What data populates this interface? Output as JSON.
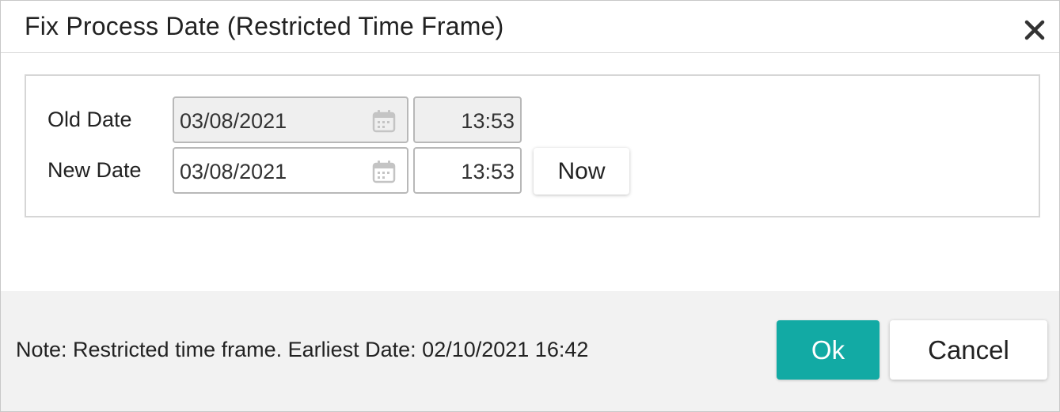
{
  "dialog": {
    "title": "Fix Process Date (Restricted Time Frame)",
    "close_icon": "close-icon"
  },
  "old_date": {
    "label": "Old Date",
    "date": "03/08/2021",
    "time": "13:53",
    "disabled": true,
    "calendar_icon": "calendar-icon"
  },
  "new_date": {
    "label": "New Date",
    "date": "03/08/2021",
    "time": "13:53",
    "calendar_icon": "calendar-icon",
    "now_label": "Now"
  },
  "footer": {
    "note": "Note: Restricted time frame. Earliest Date: 02/10/2021 16:42",
    "ok_label": "Ok",
    "cancel_label": "Cancel"
  },
  "colors": {
    "ok_button": "#12aaa4",
    "footer_bg": "#f2f2f2",
    "disabled_field_bg": "#efefef"
  }
}
